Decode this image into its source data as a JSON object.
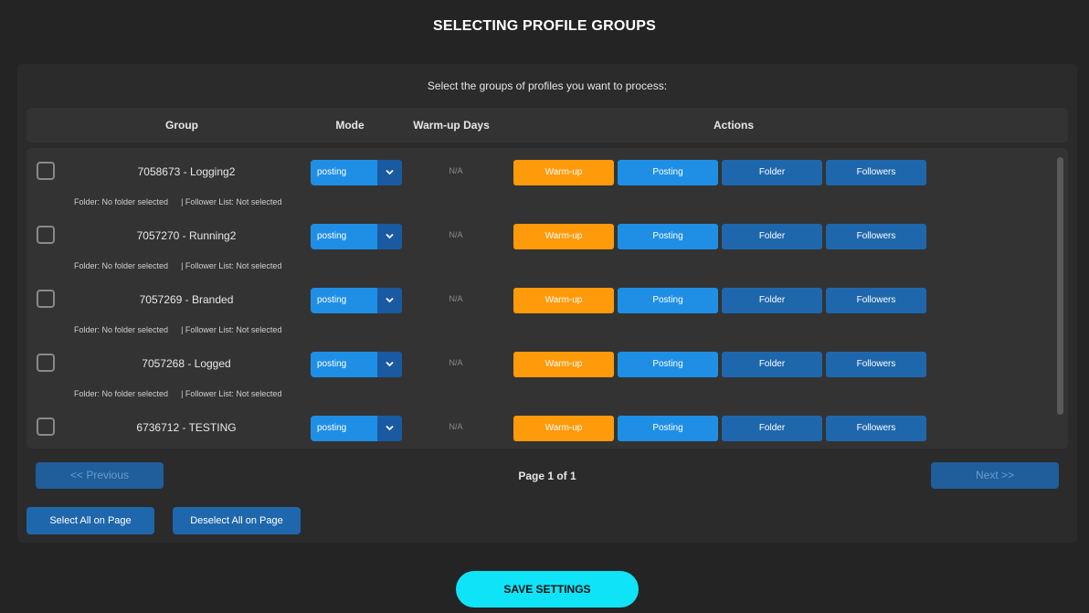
{
  "page": {
    "title": "SELECTING PROFILE GROUPS",
    "subtitle": "Select the groups of profiles you want to process:"
  },
  "table": {
    "headers": {
      "group": "Group",
      "mode": "Mode",
      "warmup_days": "Warm-up Days",
      "actions": "Actions"
    },
    "action_labels": {
      "warmup": "Warm-up",
      "posting": "Posting",
      "folder": "Folder",
      "followers": "Followers"
    },
    "rows": [
      {
        "name": "7058673 - Logging2",
        "mode": "posting",
        "warmup_days": "N/A",
        "folder_info": "Folder: No folder selected",
        "follower_info": "| Follower List: Not selected"
      },
      {
        "name": "7057270 - Running2",
        "mode": "posting",
        "warmup_days": "N/A",
        "folder_info": "Folder: No folder selected",
        "follower_info": "| Follower List: Not selected"
      },
      {
        "name": "7057269 - Branded",
        "mode": "posting",
        "warmup_days": "N/A",
        "folder_info": "Folder: No folder selected",
        "follower_info": "| Follower List: Not selected"
      },
      {
        "name": "7057268 - Logged",
        "mode": "posting",
        "warmup_days": "N/A",
        "folder_info": "Folder: No folder selected",
        "follower_info": "| Follower List: Not selected"
      },
      {
        "name": "6736712 - TESTING",
        "mode": "posting",
        "warmup_days": "N/A",
        "folder_info": "",
        "follower_info": ""
      }
    ]
  },
  "pagination": {
    "previous_label": "<< Previous",
    "next_label": "Next >>",
    "page_text": "Page 1 of 1"
  },
  "bulk": {
    "select_all_label": "Select All on Page",
    "deselect_all_label": "Deselect All on Page"
  },
  "save": {
    "label": "SAVE SETTINGS"
  },
  "colors": {
    "warmup": "#ff9a0a",
    "posting": "#1f8fe6",
    "folder": "#1f67ad",
    "save": "#0fe3f7"
  }
}
